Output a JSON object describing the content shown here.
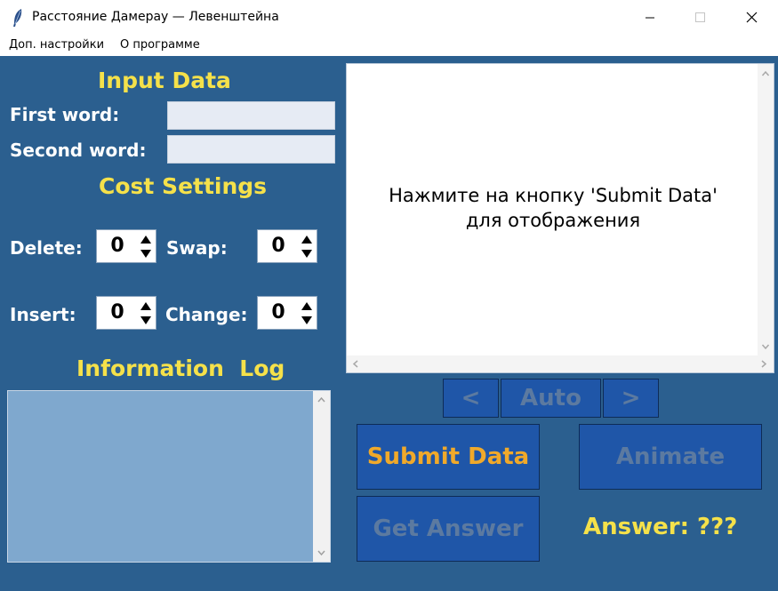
{
  "window": {
    "title": "Расстояние Дамерау — Левенштейна"
  },
  "menu": {
    "items": [
      "Доп. настройки",
      "О программе"
    ]
  },
  "input": {
    "heading": "Input Data",
    "first_word_label": "First word:",
    "first_word_value": "",
    "second_word_label": "Second word:",
    "second_word_value": ""
  },
  "costs": {
    "heading": "Cost Settings",
    "delete_label": "Delete:",
    "delete_value": "0",
    "swap_label": "Swap:",
    "swap_value": "0",
    "insert_label": "Insert:",
    "insert_value": "0",
    "change_label": "Change:",
    "change_value": "0"
  },
  "log": {
    "heading": "Information  Log",
    "content": ""
  },
  "canvas": {
    "message_line1": "Нажмите на кнопку 'Submit Data'",
    "message_line2": "для отображения"
  },
  "nav": {
    "prev": "<",
    "auto": "Auto",
    "next": ">"
  },
  "actions": {
    "submit": "Submit Data",
    "animate": "Animate",
    "get_answer": "Get Answer"
  },
  "answer": {
    "text": "Answer: ???"
  },
  "colors": {
    "background": "#2b5f8f",
    "heading": "#f5e14a",
    "button": "#1f56a8",
    "submit_text": "#f0a92a",
    "disabled_text": "#5c7aa0"
  }
}
